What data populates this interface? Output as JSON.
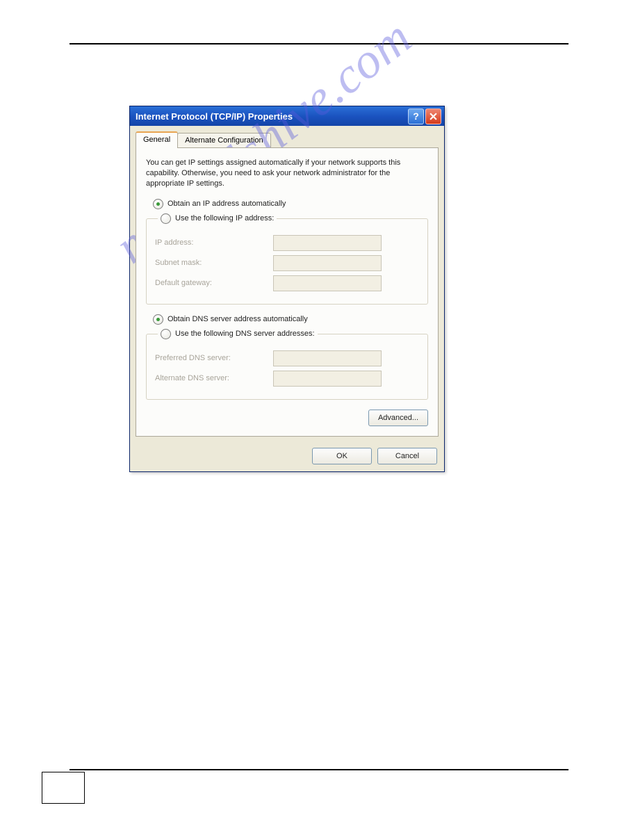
{
  "dialog": {
    "title": "Internet Protocol (TCP/IP) Properties",
    "tabs": [
      {
        "label": "General",
        "active": true
      },
      {
        "label": "Alternate Configuration",
        "active": false
      }
    ],
    "intro": "You can get IP settings assigned automatically if your network supports this capability. Otherwise, you need to ask your network administrator for the appropriate IP settings.",
    "ip_section": {
      "auto_label": "Obtain an IP address automatically",
      "manual_label": "Use the following IP address:",
      "selected": "auto",
      "fields": {
        "ip_address_label": "IP address:",
        "subnet_mask_label": "Subnet mask:",
        "default_gateway_label": "Default gateway:",
        "ip_address_value": "",
        "subnet_mask_value": "",
        "default_gateway_value": ""
      }
    },
    "dns_section": {
      "auto_label": "Obtain DNS server address automatically",
      "manual_label": "Use the following DNS server addresses:",
      "selected": "auto",
      "fields": {
        "preferred_label": "Preferred DNS server:",
        "alternate_label": "Alternate DNS server:",
        "preferred_value": "",
        "alternate_value": ""
      }
    },
    "advanced_label": "Advanced...",
    "ok_label": "OK",
    "cancel_label": "Cancel"
  },
  "watermark": "manualshive.com"
}
